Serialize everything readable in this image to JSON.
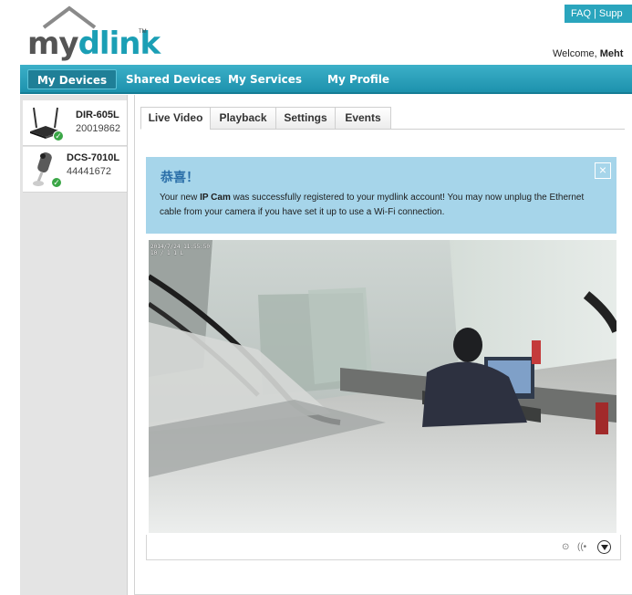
{
  "header": {
    "logo": {
      "my": "my",
      "dlink": "dlink",
      "tm": "TM"
    },
    "links": {
      "faq": "FAQ",
      "separator": "|",
      "support": "Supp"
    },
    "welcome_prefix": "Welcome,",
    "welcome_user": "Meht"
  },
  "nav": {
    "items": [
      {
        "label": "My Devices",
        "active": true
      },
      {
        "label": "Shared Devices"
      },
      {
        "label": "My Services"
      },
      {
        "label": "My Profile"
      }
    ]
  },
  "devices": [
    {
      "name": "DIR-605L",
      "id": "20019862",
      "status_icon": "check-icon"
    },
    {
      "name": "DCS-7010L",
      "id": "44441672",
      "status_icon": "check-icon"
    }
  ],
  "tabs": [
    {
      "label": "Live Video",
      "active": true
    },
    {
      "label": "Playback"
    },
    {
      "label": "Settings"
    },
    {
      "label": "Events"
    }
  ],
  "alert": {
    "title": "恭喜！",
    "text_before": "Your new ",
    "text_bold": "IP Cam",
    "text_after": " was successfully registered to your mydlink account! You may now unplug the Ethernet cable from your camera if you have set it up to use a Wi-Fi connection.",
    "close": "×"
  },
  "video": {
    "overlay_line1": "2014/7/24 11:55:50",
    "overlay_line2": "10 / 1 1 L",
    "controls": {
      "zoom": "⊙",
      "audio": "((•",
      "menu_icon": "chevron-down-icon"
    }
  },
  "colors": {
    "accent": "#1d92ad",
    "alert_bg": "#a6d5ea",
    "alert_title": "#2a6ea8",
    "check": "#3aa646"
  }
}
